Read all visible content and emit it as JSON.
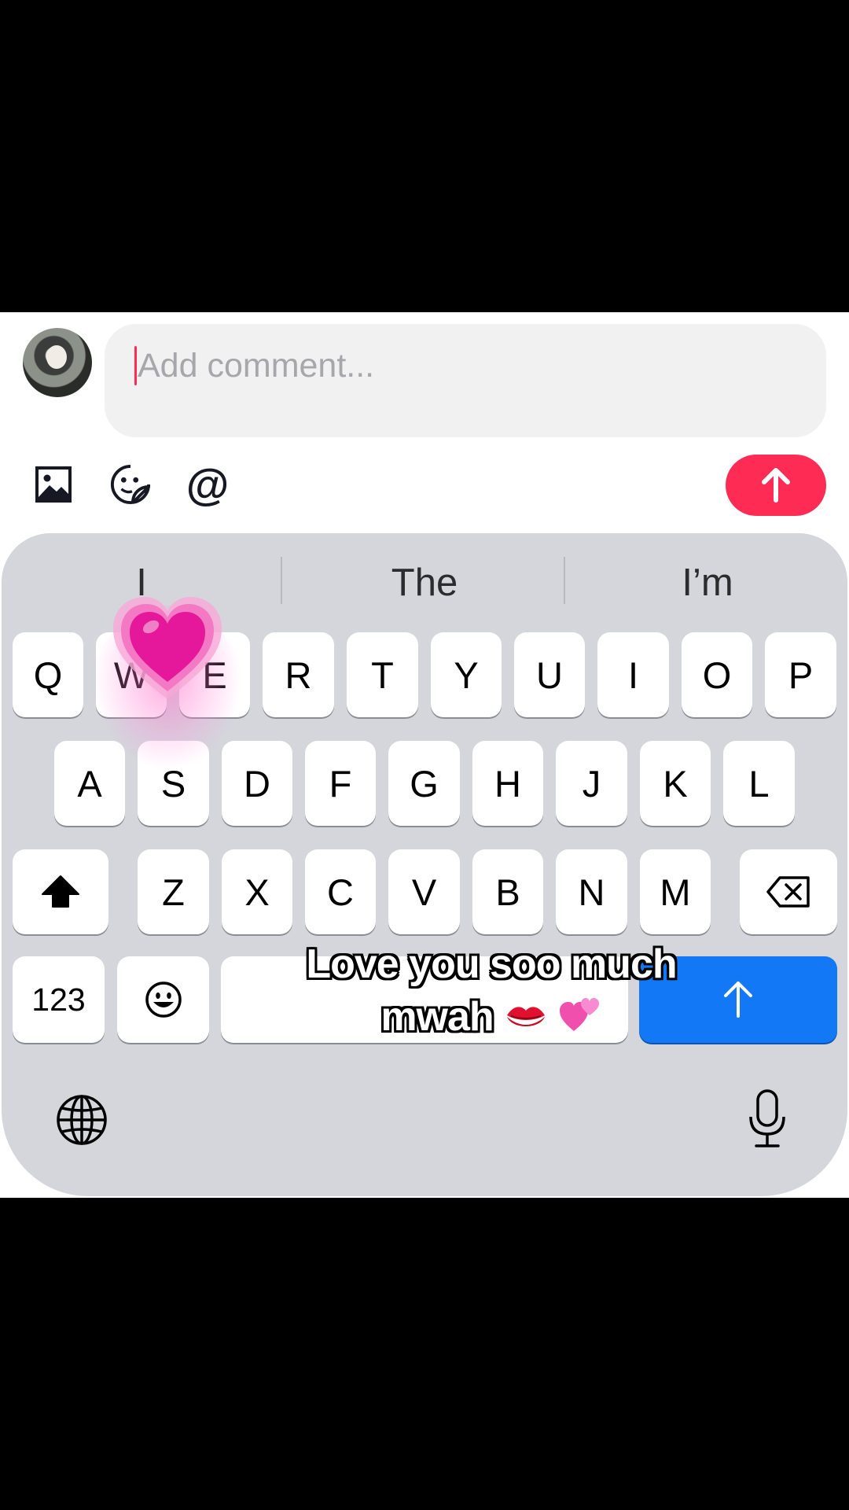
{
  "comment": {
    "placeholder": "Add comment..."
  },
  "toolbar": {
    "image_icon": "image-icon",
    "sticker_icon": "sticker-icon",
    "mention_label": "@",
    "send_icon": "arrow-up-icon"
  },
  "keyboard": {
    "suggestions": [
      "I",
      "The",
      "I’m"
    ],
    "row1": [
      "Q",
      "W",
      "E",
      "R",
      "T",
      "Y",
      "U",
      "I",
      "O",
      "P"
    ],
    "row2": [
      "A",
      "S",
      "D",
      "F",
      "G",
      "H",
      "J",
      "K",
      "L"
    ],
    "row3": [
      "Z",
      "X",
      "C",
      "V",
      "B",
      "N",
      "M"
    ],
    "numbers_label": "123",
    "shift_icon": "shift-icon",
    "delete_icon": "backspace-icon",
    "emoji_icon": "emoji-icon",
    "return_icon": "arrow-up-icon",
    "globe_icon": "globe-icon",
    "mic_icon": "microphone-icon"
  },
  "caption": {
    "line1": "Love you soo much",
    "line2": "mwah"
  },
  "colors": {
    "accent": "#fe2c55",
    "return_key": "#1378f5",
    "keyboard_bg": "#d4d6dc"
  }
}
